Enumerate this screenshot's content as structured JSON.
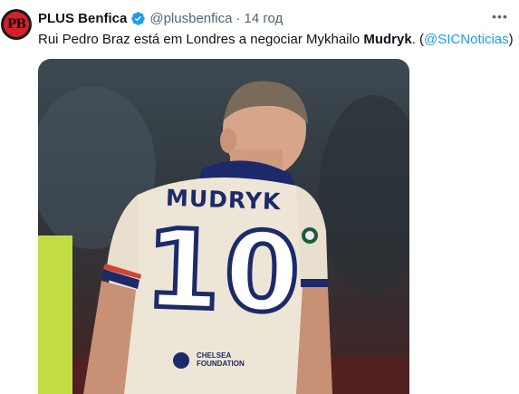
{
  "tweet": {
    "display_name": "PLUS Benfica",
    "handle": "@plusbenfica",
    "separator": "·",
    "time": "14 год",
    "more_label": "•••",
    "text_before": "Rui Pedro Braz está em Londres a negociar Mykhailo ",
    "text_bold": "Mudryk",
    "text_after": ". (",
    "mention": "@SICNoticias",
    "text_end": ")"
  },
  "avatar": {
    "initials": "PB"
  },
  "media": {
    "shirt_name": "MUDRYK",
    "shirt_number": "10",
    "sponsor_line1": "CHELSEA",
    "sponsor_line2": "FOUNDATION"
  },
  "colors": {
    "verified": "#1d9bf0",
    "link": "#1d9bf0",
    "secondary_text": "#536471",
    "kit_navy": "#1c2a6b"
  },
  "icons": {
    "verified": "verified-badge-icon",
    "more": "more-options-icon"
  }
}
